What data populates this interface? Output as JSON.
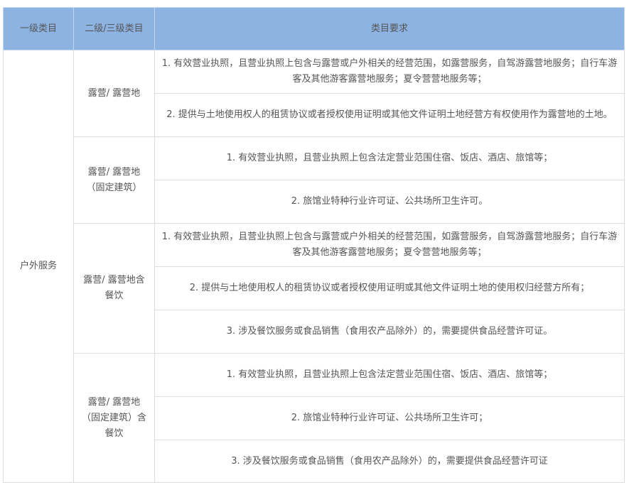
{
  "header": {
    "col1": "一级类目",
    "col2": "二级/三级类目",
    "col3": "类目要求"
  },
  "primary_category": "户外服务",
  "groups": [
    {
      "name": "露营/ 露营地",
      "requirements": [
        "1. 有效营业执照，且营业执照上包含与露营或户外相关的经营范围，如露营服务，自驾游露营地服务；自行车游客及其他游客露营地服务；夏令营营地服务等；",
        "2. 提供与土地使用权人的租赁协议或者授权使用证明或其他文件证明土地经营方有权使用作为露营地的土地。"
      ]
    },
    {
      "name": "露营/ 露营地（固定建筑）",
      "requirements": [
        "1. 有效营业执照，且营业执照上包含法定营业范围住宿、饭店、酒店、旅馆等；",
        "2. 旅馆业特种行业许可证、公共场所卫生许可。"
      ]
    },
    {
      "name": "露营/ 露营地含餐饮",
      "requirements": [
        "1. 有效营业执照，且营业执照上包含与露营或户外相关的经营范围，如露营服务，自驾游露营地服务；自行车游客及其他游客露营地服务；夏令营营地服务等；",
        "2. 提供与土地使用权人的租赁协议或者授权使用证明或其他文件证明土地的使用权归经营方所有；",
        "3. 涉及餐饮服务或食品销售（食用农产品除外）的，需要提供食品经营许可证。"
      ]
    },
    {
      "name": "露营/ 露营地（固定建筑）含餐饮",
      "requirements": [
        "1. 有效营业执照，且营业执照上包含法定营业范围住宿、饭店、酒店、旅馆等；",
        "2. 旅馆业特种行业许可证、公共场所卫生许可；",
        "3. 涉及餐饮服务或食品销售（食用农产品除外）的，需要提供食品经营许可证"
      ]
    }
  ]
}
